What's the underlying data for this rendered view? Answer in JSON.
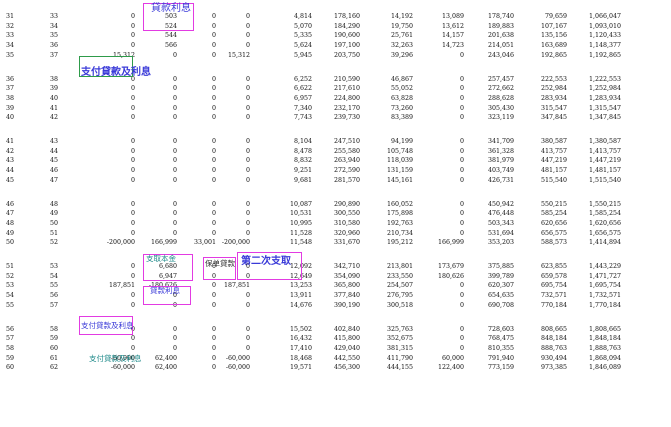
{
  "rows": [
    [
      "31",
      "33",
      "0",
      "503",
      "0",
      "0",
      "4,814",
      "178,160",
      "14,192",
      "13,089",
      "178,740",
      "79,659",
      "1,066,047"
    ],
    [
      "32",
      "34",
      "0",
      "524",
      "0",
      "0",
      "5,070",
      "184,290",
      "19,750",
      "13,612",
      "189,883",
      "107,167",
      "1,093,010"
    ],
    [
      "33",
      "35",
      "0",
      "544",
      "0",
      "0",
      "5,335",
      "190,600",
      "25,761",
      "14,157",
      "201,638",
      "135,156",
      "1,120,433"
    ],
    [
      "34",
      "36",
      "0",
      "566",
      "0",
      "0",
      "5,624",
      "197,100",
      "32,263",
      "14,723",
      "214,051",
      "163,689",
      "1,148,377"
    ],
    [
      "35",
      "37",
      "15,312",
      "0",
      "0",
      "15,312",
      "5,945",
      "203,750",
      "39,296",
      "0",
      "243,046",
      "192,865",
      "1,192,865"
    ],
    [
      "36",
      "38",
      "0",
      "0",
      "0",
      "0",
      "6,252",
      "210,590",
      "46,867",
      "0",
      "257,457",
      "222,553",
      "1,222,553"
    ],
    [
      "37",
      "39",
      "0",
      "0",
      "0",
      "0",
      "6,622",
      "217,610",
      "55,052",
      "0",
      "272,662",
      "252,984",
      "1,252,984"
    ],
    [
      "38",
      "40",
      "0",
      "0",
      "0",
      "0",
      "6,957",
      "224,800",
      "63,828",
      "0",
      "288,628",
      "283,934",
      "1,283,934"
    ],
    [
      "39",
      "41",
      "0",
      "0",
      "0",
      "0",
      "7,340",
      "232,170",
      "73,260",
      "0",
      "305,430",
      "315,547",
      "1,315,547"
    ],
    [
      "40",
      "42",
      "0",
      "0",
      "0",
      "0",
      "7,743",
      "239,730",
      "83,389",
      "0",
      "323,119",
      "347,845",
      "1,347,845"
    ],
    [
      "41",
      "43",
      "0",
      "0",
      "0",
      "0",
      "8,104",
      "247,510",
      "94,199",
      "0",
      "341,709",
      "380,587",
      "1,380,587"
    ],
    [
      "42",
      "44",
      "0",
      "0",
      "0",
      "0",
      "8,478",
      "255,580",
      "105,748",
      "0",
      "361,328",
      "413,757",
      "1,413,757"
    ],
    [
      "43",
      "45",
      "0",
      "0",
      "0",
      "0",
      "8,832",
      "263,940",
      "118,039",
      "0",
      "381,979",
      "447,219",
      "1,447,219"
    ],
    [
      "44",
      "46",
      "0",
      "0",
      "0",
      "0",
      "9,251",
      "272,590",
      "131,159",
      "0",
      "403,749",
      "481,157",
      "1,481,157"
    ],
    [
      "45",
      "47",
      "0",
      "0",
      "0",
      "0",
      "9,681",
      "281,570",
      "145,161",
      "0",
      "426,731",
      "515,540",
      "1,515,540"
    ],
    [
      "46",
      "48",
      "0",
      "0",
      "0",
      "0",
      "10,087",
      "290,890",
      "160,052",
      "0",
      "450,942",
      "550,215",
      "1,550,215"
    ],
    [
      "47",
      "49",
      "0",
      "0",
      "0",
      "0",
      "10,531",
      "300,550",
      "175,898",
      "0",
      "476,448",
      "585,254",
      "1,585,254"
    ],
    [
      "48",
      "50",
      "0",
      "0",
      "0",
      "0",
      "10,995",
      "310,580",
      "192,763",
      "0",
      "503,343",
      "620,656",
      "1,620,656"
    ],
    [
      "49",
      "51",
      "0",
      "0",
      "0",
      "0",
      "11,528",
      "320,960",
      "210,734",
      "0",
      "531,694",
      "656,575",
      "1,656,575"
    ],
    [
      "50",
      "52",
      "-200,000",
      "166,999",
      "33,001",
      "-200,000",
      "11,548",
      "331,670",
      "195,212",
      "166,999",
      "353,203",
      "588,573",
      "1,414,894"
    ],
    [
      "51",
      "53",
      "0",
      "6,680",
      "0",
      "0",
      "12,092",
      "342,710",
      "213,801",
      "173,679",
      "375,885",
      "623,855",
      "1,443,229"
    ],
    [
      "52",
      "54",
      "0",
      "6,947",
      "0",
      "0",
      "12,649",
      "354,090",
      "233,550",
      "180,626",
      "399,789",
      "659,578",
      "1,471,727"
    ],
    [
      "53",
      "55",
      "187,851",
      "-180,626",
      "0",
      "187,851",
      "13,253",
      "365,800",
      "254,507",
      "0",
      "620,307",
      "695,754",
      "1,695,754"
    ],
    [
      "54",
      "56",
      "0",
      "0",
      "0",
      "0",
      "13,911",
      "377,840",
      "276,795",
      "0",
      "654,635",
      "732,571",
      "1,732,571"
    ],
    [
      "55",
      "57",
      "0",
      "0",
      "0",
      "0",
      "14,676",
      "390,190",
      "300,518",
      "0",
      "690,708",
      "770,184",
      "1,770,184"
    ],
    [
      "56",
      "58",
      "0",
      "0",
      "0",
      "0",
      "15,502",
      "402,840",
      "325,763",
      "0",
      "728,603",
      "808,665",
      "1,808,665"
    ],
    [
      "57",
      "59",
      "0",
      "0",
      "0",
      "0",
      "16,432",
      "415,800",
      "352,675",
      "0",
      "768,475",
      "848,184",
      "1,848,184"
    ],
    [
      "58",
      "60",
      "0",
      "0",
      "0",
      "0",
      "17,410",
      "429,040",
      "381,315",
      "0",
      "810,355",
      "888,763",
      "1,888,763"
    ],
    [
      "59",
      "61",
      "-60,000",
      "62,400",
      "0",
      "-60,000",
      "18,468",
      "442,550",
      "411,790",
      "60,000",
      "791,940",
      "930,494",
      "1,868,094"
    ],
    [
      "60",
      "62",
      "-60,000",
      "62,400",
      "0",
      "-60,000",
      "19,571",
      "456,300",
      "444,155",
      "122,400",
      "773,159",
      "973,385",
      "1,846,089"
    ]
  ],
  "annotations": {
    "loan_interest": "貸款利息",
    "repay_loan_interest": "支付貸款及利息",
    "withdraw_principal": "支取本金",
    "policy_loan": "保单貸款",
    "second_withdrawal": "第二次支取",
    "loan_interest_2": "貸款利息",
    "repay_loan_interest_2": "支付貸款及利息",
    "repay_loan_interest_3": "支付貸款及利息"
  },
  "colors": {
    "annotation_blue": "#3a3ad8",
    "annotation_teal": "#1f8a8a",
    "box_magenta": "#e23be2",
    "box_green": "#2e9b4a",
    "text": "#111111"
  }
}
